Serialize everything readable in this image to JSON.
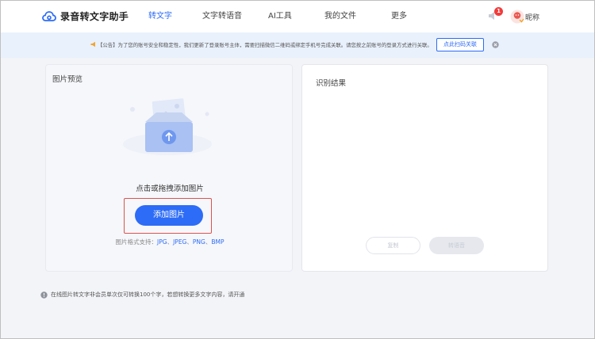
{
  "header": {
    "app_name": "录音转文字助手",
    "nav": [
      {
        "label": "转文字",
        "active": true
      },
      {
        "label": "文字转语音",
        "active": false
      },
      {
        "label": "AI工具",
        "active": false
      },
      {
        "label": "我的文件",
        "active": false
      },
      {
        "label": "更多",
        "active": false
      }
    ],
    "notification_count": "1",
    "nickname": "昵称"
  },
  "notice": {
    "text": "【公告】为了您的账号安全和稳定性，我们更新了登录账号主体，需要扫描微信二维码或绑定手机号完成关联。请您按之前账号的登录方式进行关联。",
    "button_label": "点此扫码关联"
  },
  "left_panel": {
    "title": "图片预览",
    "hint": "点击或拖拽添加图片",
    "add_button": "添加图片",
    "formats_prefix": "图片格式支持：",
    "formats": [
      "JPG",
      "JPEG",
      "PNG",
      "BMP"
    ]
  },
  "right_panel": {
    "title": "识别结果",
    "copy_button": "复制",
    "convert_button": "转语音"
  },
  "footer": {
    "note": "在线图片转文字非会员单次仅可转换100个字，若想转换更多文字内容，请开通"
  },
  "colors": {
    "accent": "#2d6cf6",
    "badge": "#f23b3b",
    "notice_bg": "#e9f1fc"
  }
}
